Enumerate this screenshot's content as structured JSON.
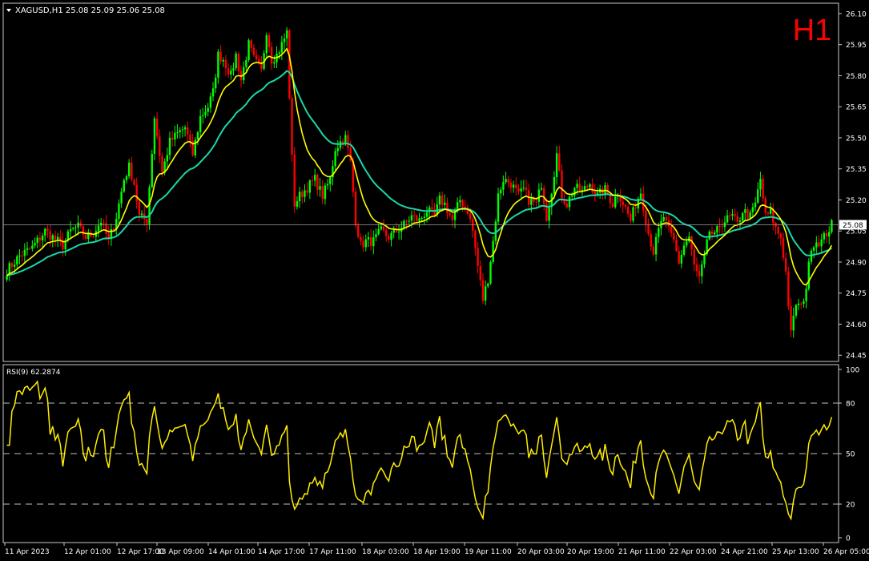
{
  "header": {
    "symbol_info": "XAGUSD,H1  25.08 25.09 25.06 25.08",
    "timeframe_badge": "H1"
  },
  "colors": {
    "background": "#000000",
    "bull_candle": "#00ff00",
    "bear_candle": "#ff0000",
    "fast_ma": "#ffff00",
    "slow_ma": "#19d8a8",
    "rsi_line": "#ffee00",
    "badge": "#ff0000",
    "price_line": "#a0a0a0"
  },
  "chart_data": [
    {
      "type": "candlestick",
      "title": "XAGUSD,H1",
      "ylim": [
        24.42,
        26.15
      ],
      "y_ticks": [
        "26.10",
        "25.95",
        "25.80",
        "25.65",
        "25.50",
        "25.35",
        "25.20",
        "25.05",
        "24.90",
        "24.75",
        "24.60",
        "24.45"
      ],
      "current_price_label": "25.08",
      "x_tick_labels": [
        "11 Apr 2023",
        "12 Apr 01:00",
        "12 Apr 17:00",
        "13 Apr 09:00",
        "14 Apr 01:00",
        "14 Apr 17:00",
        "17 Apr 11:00",
        "18 Apr 03:00",
        "18 Apr 19:00",
        "19 Apr 11:00",
        "20 Apr 03:00",
        "20 Apr 19:00",
        "21 Apr 11:00",
        "22 Apr 03:00",
        "24 Apr 21:00",
        "25 Apr 13:00",
        "26 Apr 05:00"
      ],
      "close_anchors": [
        [
          0,
          24.86
        ],
        [
          5,
          24.93
        ],
        [
          10,
          24.97
        ],
        [
          15,
          25.05
        ],
        [
          18,
          25.02
        ],
        [
          22,
          24.98
        ],
        [
          25,
          25.05
        ],
        [
          28,
          25.07
        ],
        [
          31,
          25.02
        ],
        [
          34,
          25.04
        ],
        [
          37,
          25.1
        ],
        [
          40,
          25.0
        ],
        [
          43,
          25.12
        ],
        [
          46,
          25.3
        ],
        [
          48,
          25.36
        ],
        [
          50,
          25.28
        ],
        [
          52,
          25.12
        ],
        [
          55,
          25.1
        ],
        [
          58,
          25.6
        ],
        [
          61,
          25.33
        ],
        [
          64,
          25.48
        ],
        [
          67,
          25.52
        ],
        [
          70,
          25.55
        ],
        [
          73,
          25.42
        ],
        [
          76,
          25.6
        ],
        [
          79,
          25.65
        ],
        [
          81,
          25.72
        ],
        [
          83,
          25.9
        ],
        [
          85,
          25.88
        ],
        [
          88,
          25.8
        ],
        [
          90,
          25.9
        ],
        [
          92,
          25.78
        ],
        [
          95,
          25.95
        ],
        [
          97,
          25.88
        ],
        [
          100,
          25.82
        ],
        [
          102,
          26.02
        ],
        [
          104,
          25.88
        ],
        [
          106,
          25.9
        ],
        [
          108,
          25.95
        ],
        [
          110,
          26.01
        ],
        [
          112,
          25.4
        ],
        [
          113,
          25.18
        ],
        [
          115,
          25.22
        ],
        [
          118,
          25.26
        ],
        [
          121,
          25.3
        ],
        [
          124,
          25.22
        ],
        [
          127,
          25.3
        ],
        [
          129,
          25.45
        ],
        [
          131,
          25.48
        ],
        [
          133,
          25.5
        ],
        [
          135,
          25.38
        ],
        [
          137,
          25.1
        ],
        [
          139,
          24.98
        ],
        [
          141,
          25.0
        ],
        [
          144,
          25.0
        ],
        [
          147,
          25.05
        ],
        [
          150,
          25.02
        ],
        [
          153,
          25.05
        ],
        [
          156,
          25.08
        ],
        [
          159,
          25.12
        ],
        [
          162,
          25.1
        ],
        [
          165,
          25.15
        ],
        [
          168,
          25.12
        ],
        [
          170,
          25.2
        ],
        [
          172,
          25.18
        ],
        [
          175,
          25.1
        ],
        [
          178,
          25.2
        ],
        [
          181,
          25.15
        ],
        [
          183,
          25.05
        ],
        [
          185,
          24.88
        ],
        [
          187,
          24.72
        ],
        [
          189,
          24.82
        ],
        [
          191,
          25.0
        ],
        [
          193,
          25.22
        ],
        [
          195,
          25.3
        ],
        [
          198,
          25.28
        ],
        [
          201,
          25.22
        ],
        [
          203,
          25.25
        ],
        [
          205,
          25.2
        ],
        [
          208,
          25.18
        ],
        [
          210,
          25.28
        ],
        [
          212,
          25.12
        ],
        [
          214,
          25.25
        ],
        [
          216,
          25.42
        ],
        [
          218,
          25.22
        ],
        [
          220,
          25.18
        ],
        [
          223,
          25.26
        ],
        [
          226,
          25.24
        ],
        [
          229,
          25.28
        ],
        [
          232,
          25.22
        ],
        [
          235,
          25.25
        ],
        [
          238,
          25.18
        ],
        [
          240,
          25.24
        ],
        [
          243,
          25.16
        ],
        [
          245,
          25.1
        ],
        [
          247,
          25.18
        ],
        [
          249,
          25.24
        ],
        [
          252,
          25.04
        ],
        [
          254,
          24.95
        ],
        [
          256,
          25.05
        ],
        [
          258,
          25.12
        ],
        [
          260,
          25.05
        ],
        [
          262,
          25.0
        ],
        [
          264,
          24.9
        ],
        [
          266,
          24.98
        ],
        [
          268,
          25.02
        ],
        [
          270,
          24.88
        ],
        [
          272,
          24.82
        ],
        [
          274,
          24.92
        ],
        [
          276,
          25.05
        ],
        [
          278,
          25.02
        ],
        [
          280,
          25.08
        ],
        [
          282,
          25.1
        ],
        [
          285,
          25.12
        ],
        [
          287,
          25.08
        ],
        [
          289,
          25.15
        ],
        [
          292,
          25.12
        ],
        [
          294,
          25.18
        ],
        [
          296,
          25.3
        ],
        [
          298,
          25.12
        ],
        [
          300,
          25.14
        ],
        [
          302,
          25.06
        ],
        [
          304,
          25.02
        ],
        [
          306,
          24.85
        ],
        [
          308,
          24.55
        ],
        [
          310,
          24.7
        ],
        [
          312,
          24.68
        ],
        [
          314,
          24.78
        ],
        [
          316,
          24.98
        ],
        [
          318,
          25.0
        ],
        [
          320,
          25.0
        ],
        [
          322,
          25.04
        ],
        [
          324,
          25.08
        ]
      ],
      "series": [
        {
          "name": "fast-ma",
          "period_style": "short"
        },
        {
          "name": "slow-ma",
          "period_style": "long"
        }
      ]
    },
    {
      "type": "line",
      "title": "RSI(9) 62.2874",
      "ylim": [
        0,
        100
      ],
      "y_ticks": [
        "100",
        "80",
        "50",
        "20",
        "0"
      ],
      "levels": [
        80,
        50,
        20
      ]
    }
  ]
}
